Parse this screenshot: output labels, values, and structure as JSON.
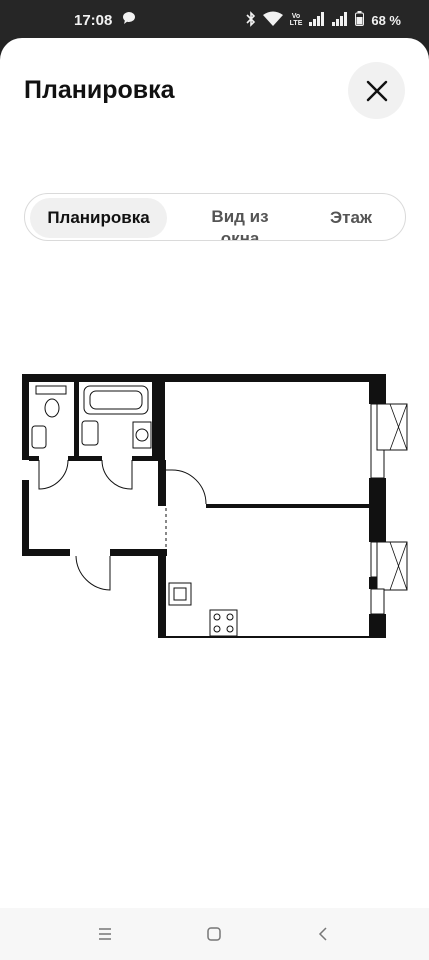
{
  "status_bar": {
    "time": "17:08",
    "network_label_top": "Vo",
    "network_label_bottom": "LTE",
    "battery": "68 %"
  },
  "header": {
    "title": "Планировка"
  },
  "tabs": [
    {
      "label": "Планировка",
      "active": true
    },
    {
      "label_line1": "Вид из",
      "label_line2": "окна",
      "active": false
    },
    {
      "label": "Этаж",
      "active": false
    }
  ],
  "icons": {
    "close": "close-icon",
    "chat": "chat-bubble-icon",
    "bluetooth": "bluetooth-icon",
    "wifi": "wifi-icon",
    "signal": "signal-icon",
    "battery": "battery-icon",
    "nav_recent": "recent-apps-icon",
    "nav_home": "home-icon",
    "nav_back": "back-icon"
  },
  "colors": {
    "sheet_background": "#ffffff",
    "status_bar_background": "#262626",
    "active_tab_background": "#f0f0f0",
    "wall_color": "#111111"
  }
}
